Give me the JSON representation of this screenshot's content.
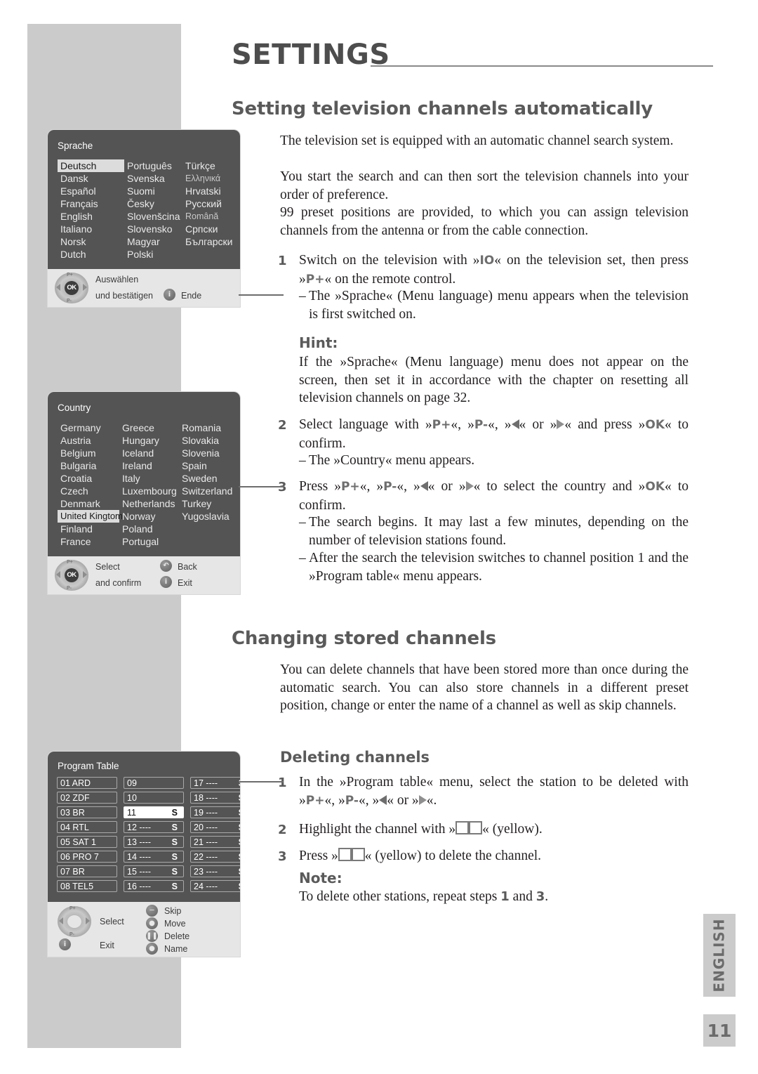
{
  "header": {
    "title": "SETTINGS"
  },
  "sections": {
    "auto_heading": "Setting television channels automatically",
    "auto_intro_1": "The television set is equipped with an automatic channel search system.",
    "auto_intro_2": "You start the search and can then sort the television channels into your order of preference.",
    "auto_intro_3": "99 preset positions are provided, to which you can assign television channels from the antenna or from the cable connection.",
    "changing_heading": "Changing stored channels",
    "changing_intro": "You can delete channels that have been stored more than once during the automatic search. You can also store channels in a different preset position, change or enter the name of a channel as well as skip channels.",
    "deleting_heading": "Deleting channels"
  },
  "steps_auto": {
    "s1_num": "1",
    "s1_a": "Switch on the television with »",
    "s1_key1": "IO",
    "s1_b": "« on the television set, then press »",
    "s1_key2": "P+",
    "s1_c": "« on the remote control.",
    "s1_sub": "The »Sprache« (Menu language) menu appears when the television is first switched on.",
    "hint_label": "Hint:",
    "hint_text": "If the »Sprache« (Menu language) menu does not appear on the screen, then set it in accordance with the chapter on resetting all television channels on page 32.",
    "s2_num": "2",
    "s2_a": "Select language with »",
    "s2_key1": "P+",
    "s2_b": "«, »",
    "s2_key2": "P-",
    "s2_c": "«, »",
    "s2_d": "« or »",
    "s2_e": "« and press »",
    "s2_key3": "OK",
    "s2_f": "« to confirm.",
    "s2_sub": "The »Country« menu appears.",
    "s3_num": "3",
    "s3_a": "Press »",
    "s3_key1": "P+",
    "s3_b": "«, »",
    "s3_key2": "P-",
    "s3_c": "«, »",
    "s3_d": "« or »",
    "s3_e": "« to select the country and »",
    "s3_key3": "OK",
    "s3_f": "« to confirm.",
    "s3_sub1": "The search begins. It may last a few minutes, depending on the number of television stations found.",
    "s3_sub2": "After the search the television switches to channel position 1 and the »Program table« menu appears."
  },
  "steps_delete": {
    "d1_num": "1",
    "d1_a": "In the »Program table« menu, select the station to be deleted with »",
    "d1_key1": "P+",
    "d1_b": "«, »",
    "d1_key2": "P-",
    "d1_c": "«, »",
    "d1_d": "« or »",
    "d1_e": "«.",
    "d2_num": "2",
    "d2_a": "Highlight the channel with »",
    "d2_b": "« (yellow).",
    "d3_num": "3",
    "d3_a": "Press »",
    "d3_b": "« (yellow) to delete the channel.",
    "note_label": "Note:",
    "note_a": "To delete other stations, repeat steps ",
    "note_n1": "1",
    "note_b": " and ",
    "note_n2": "3",
    "note_c": "."
  },
  "osd_sprache": {
    "title": "Sprache",
    "col1": [
      "Deutsch",
      "Dansk",
      "Español",
      "Français",
      "English",
      "Italiano",
      "Norsk",
      "Dutch"
    ],
    "col2": [
      "Português",
      "Svenska",
      "Suomi",
      "Česky",
      "Slovenšcina",
      "Slovensko",
      "Magyar",
      "Polski"
    ],
    "col3": [
      "Türkçe",
      "Ελληνικά",
      "Hrvatski",
      "Русский",
      "Română",
      "Српски",
      "Български"
    ],
    "selected": "Deutsch",
    "foot_line1": "Auswählen",
    "foot_line2": "und bestätigen",
    "foot_exit": "Ende",
    "ok_label": "OK",
    "info_glyph": "i"
  },
  "osd_country": {
    "title": "Country",
    "col1": [
      "Germany",
      "Austria",
      "Belgium",
      "Bulgaria",
      "Croatia",
      "Czech",
      "Denmark",
      "United Kingtom",
      "Finland",
      "France"
    ],
    "col2": [
      "Greece",
      "Hungary",
      "Iceland",
      "Ireland",
      "Italy",
      "Luxembourg",
      "Netherlands",
      "Norway",
      "Poland",
      "Portugal"
    ],
    "col3": [
      "Romania",
      "Slovakia",
      "Slovenia",
      "Spain",
      "Sweden",
      "Switzerland",
      "Turkey",
      "Yugoslavia"
    ],
    "selected": "United Kingtom",
    "foot_line1": "Select",
    "foot_line2": "and confirm",
    "foot_back": "Back",
    "foot_exit": "Exit",
    "ok_label": "OK",
    "back_glyph": "↶",
    "info_glyph": "i"
  },
  "osd_program_table": {
    "title": "Program Table",
    "col1": [
      {
        "label": "01 ARD",
        "s": ""
      },
      {
        "label": "02 ZDF",
        "s": ""
      },
      {
        "label": "03 BR",
        "s": ""
      },
      {
        "label": "04 RTL",
        "s": ""
      },
      {
        "label": "05 SAT 1",
        "s": ""
      },
      {
        "label": "06 PRO 7",
        "s": ""
      },
      {
        "label": "07 BR",
        "s": ""
      },
      {
        "label": "08 TEL5",
        "s": ""
      }
    ],
    "col2": [
      {
        "label": "09",
        "s": ""
      },
      {
        "label": "10",
        "s": ""
      },
      {
        "label": "11",
        "s": "S"
      },
      {
        "label": "12 ----",
        "s": "S"
      },
      {
        "label": "13 ----",
        "s": "S"
      },
      {
        "label": "14 ----",
        "s": "S"
      },
      {
        "label": "15 ----",
        "s": "S"
      },
      {
        "label": "16 ----",
        "s": "S"
      }
    ],
    "col3": [
      {
        "label": "17 ----",
        "s": "S"
      },
      {
        "label": "18 ----",
        "s": "S"
      },
      {
        "label": "19 ----",
        "s": "S"
      },
      {
        "label": "20 ----",
        "s": "S"
      },
      {
        "label": "21 ----",
        "s": "S"
      },
      {
        "label": "22 ----",
        "s": "S"
      },
      {
        "label": "23 ----",
        "s": "S"
      },
      {
        "label": "24 ----",
        "s": "S"
      }
    ],
    "selected": "11",
    "foot_select": "Select",
    "foot_exit": "Exit",
    "foot_skip": "Skip",
    "foot_move": "Move",
    "foot_delete": "Delete",
    "foot_name": "Name",
    "info_glyph": "i"
  },
  "footer": {
    "language_tab": "ENGLISH",
    "page_number": "11"
  },
  "colors": {
    "band_gray": "#cbcbcb",
    "osd_dark": "#545454",
    "osd_light": "#e6e6e6",
    "heading_gray": "#5a5a5a",
    "key_gray": "#6e6e6e"
  }
}
